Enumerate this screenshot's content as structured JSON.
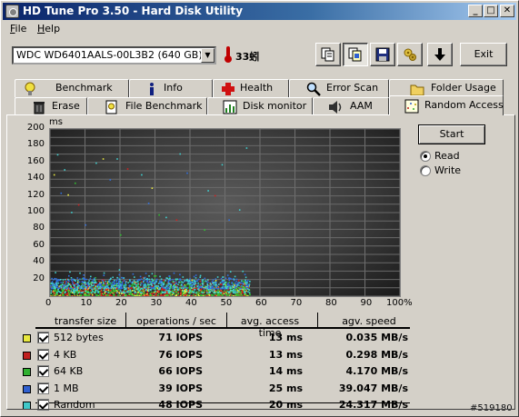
{
  "window": {
    "title": "HD Tune Pro 3.50 - Hard Disk Utility",
    "menu": [
      "File",
      "Help"
    ]
  },
  "toolbar": {
    "drive": "WDC WD6401AALS-00L3B2 (640 GB)",
    "temperature": "33蚓",
    "exit_label": "Exit",
    "buttons": [
      "copy-info-icon",
      "copy-screenshot-icon",
      "save-icon",
      "options-icon",
      "download-icon"
    ]
  },
  "tabs": {
    "row1": [
      {
        "label": "Benchmark",
        "icon": "bulb-icon"
      },
      {
        "label": "Info",
        "icon": "info-icon"
      },
      {
        "label": "Health",
        "icon": "health-cross-icon"
      },
      {
        "label": "Error Scan",
        "icon": "magnifier-icon"
      },
      {
        "label": "Folder Usage",
        "icon": "folder-icon"
      }
    ],
    "row2": [
      {
        "label": "Erase",
        "icon": "trash-icon"
      },
      {
        "label": "File Benchmark",
        "icon": "file-benchmark-icon"
      },
      {
        "label": "Disk monitor",
        "icon": "disk-monitor-icon"
      },
      {
        "label": "AAM",
        "icon": "speaker-icon"
      },
      {
        "label": "Random Access",
        "icon": "random-access-icon",
        "active": true
      }
    ]
  },
  "controls": {
    "start_label": "Start",
    "mode_options": [
      "Read",
      "Write"
    ],
    "mode_selected": "Read"
  },
  "chart_data": {
    "type": "scatter",
    "y_unit": "ms",
    "ylim": [
      0,
      200
    ],
    "y_ticks": [
      "200",
      "180",
      "160",
      "140",
      "120",
      "100",
      "80",
      "60",
      "40",
      "20"
    ],
    "x_ticks": [
      "0",
      "10",
      "20",
      "30",
      "40",
      "50",
      "60",
      "70",
      "80",
      "90",
      "100%"
    ],
    "xlim": [
      0,
      100
    ],
    "grid": true,
    "series": [
      {
        "name": "512 bytes",
        "color": "#e8e840"
      },
      {
        "name": "4 KB",
        "color": "#d02020"
      },
      {
        "name": "64 KB",
        "color": "#30c030"
      },
      {
        "name": "1 MB",
        "color": "#3070e0"
      },
      {
        "name": "Random",
        "color": "#40d0d0"
      }
    ],
    "point_clusters": [
      {
        "series": "512 bytes",
        "x_range": [
          0,
          57
        ],
        "y_range": [
          1,
          22
        ],
        "count": 420
      },
      {
        "series": "4 KB",
        "x_range": [
          0,
          57
        ],
        "y_range": [
          1,
          24
        ],
        "count": 420
      },
      {
        "series": "64 KB",
        "x_range": [
          0,
          57
        ],
        "y_range": [
          2,
          26
        ],
        "count": 420
      },
      {
        "series": "1 MB",
        "x_range": [
          0,
          57
        ],
        "y_range": [
          10,
          30
        ],
        "count": 420
      },
      {
        "series": "Random",
        "x_range": [
          0,
          57
        ],
        "y_range": [
          5,
          33
        ],
        "count": 420
      }
    ],
    "outliers": [
      {
        "series": "Random",
        "x": 2,
        "y": 170
      },
      {
        "series": "Random",
        "x": 4,
        "y": 152
      },
      {
        "series": "Random",
        "x": 6,
        "y": 101
      },
      {
        "series": "Random",
        "x": 13,
        "y": 160
      },
      {
        "series": "Random",
        "x": 19,
        "y": 165
      },
      {
        "series": "Random",
        "x": 26,
        "y": 146
      },
      {
        "series": "Random",
        "x": 33,
        "y": 95
      },
      {
        "series": "Random",
        "x": 37,
        "y": 171
      },
      {
        "series": "Random",
        "x": 45,
        "y": 127
      },
      {
        "series": "Random",
        "x": 49,
        "y": 158
      },
      {
        "series": "Random",
        "x": 54,
        "y": 104
      },
      {
        "series": "Random",
        "x": 56,
        "y": 178
      },
      {
        "series": "1 MB",
        "x": 3,
        "y": 124
      },
      {
        "series": "1 MB",
        "x": 10,
        "y": 86
      },
      {
        "series": "1 MB",
        "x": 17,
        "y": 140
      },
      {
        "series": "1 MB",
        "x": 28,
        "y": 112
      },
      {
        "series": "1 MB",
        "x": 39,
        "y": 148
      },
      {
        "series": "1 MB",
        "x": 51,
        "y": 92
      },
      {
        "series": "64 KB",
        "x": 7,
        "y": 136
      },
      {
        "series": "64 KB",
        "x": 20,
        "y": 74
      },
      {
        "series": "64 KB",
        "x": 31,
        "y": 98
      },
      {
        "series": "64 KB",
        "x": 44,
        "y": 80
      },
      {
        "series": "512 bytes",
        "x": 1,
        "y": 146
      },
      {
        "series": "512 bytes",
        "x": 5,
        "y": 122
      },
      {
        "series": "512 bytes",
        "x": 15,
        "y": 165
      },
      {
        "series": "512 bytes",
        "x": 29,
        "y": 130
      },
      {
        "series": "4 KB",
        "x": 8,
        "y": 110
      },
      {
        "series": "4 KB",
        "x": 22,
        "y": 153
      },
      {
        "series": "4 KB",
        "x": 36,
        "y": 92
      },
      {
        "series": "4 KB",
        "x": 47,
        "y": 121
      }
    ]
  },
  "results": {
    "headers": [
      "transfer size",
      "operations / sec",
      "avg. access time",
      "agv. speed"
    ],
    "rows": [
      {
        "size": "512 bytes",
        "ops": "71 IOPS",
        "access": "13 ms",
        "speed": "0.035 MB/s",
        "color": "#e8e840"
      },
      {
        "size": "4 KB",
        "ops": "76 IOPS",
        "access": "13 ms",
        "speed": "0.298 MB/s",
        "color": "#c02020"
      },
      {
        "size": "64 KB",
        "ops": "66 IOPS",
        "access": "14 ms",
        "speed": "4.170 MB/s",
        "color": "#30b030"
      },
      {
        "size": "1 MB",
        "ops": "39 IOPS",
        "access": "25 ms",
        "speed": "39.047 MB/s",
        "color": "#3060d0"
      },
      {
        "size": "Random",
        "ops": "48 IOPS",
        "access": "20 ms",
        "speed": "24.317 MB/s",
        "color": "#40c8c8"
      }
    ]
  },
  "watermark": "#519180"
}
